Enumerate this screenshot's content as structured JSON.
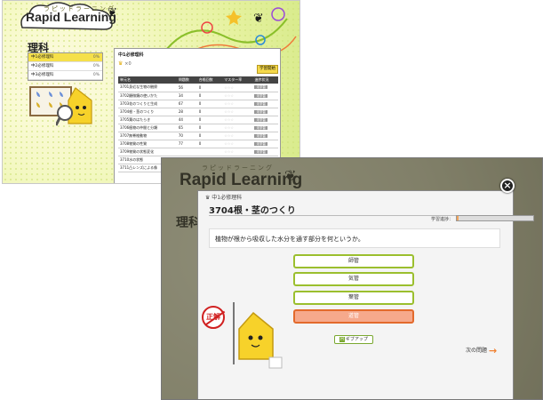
{
  "back": {
    "logo_sub": "ラピッドラーニング",
    "logo": "Rapid Learning",
    "section_title": "理科",
    "sidebar": [
      {
        "label": "中1必修理科",
        "pct": "0%",
        "active": true
      },
      {
        "label": "中2必修理科",
        "pct": "0%",
        "active": false
      },
      {
        "label": "中3必修理科",
        "pct": "0%",
        "active": false
      }
    ],
    "panel_title": "中1必修理科",
    "crown_count": "×0",
    "start_button": "学習開始",
    "columns": [
      "単元名",
      "問題数",
      "合格回数",
      "マスター率",
      "進捗状況"
    ],
    "rows": [
      {
        "name": "3701身近な生物の観察",
        "count": "56",
        "passed": "0"
      },
      {
        "name": "3702顕微鏡の使いかた",
        "count": "34",
        "passed": "0"
      },
      {
        "name": "3703花のつくりと生成",
        "count": "67",
        "passed": "0"
      },
      {
        "name": "3704根・茎のつくり",
        "count": "28",
        "passed": "0"
      },
      {
        "name": "3705葉のはたらき",
        "count": "44",
        "passed": "0"
      },
      {
        "name": "3706植物の仲間と分類",
        "count": "65",
        "passed": "0"
      },
      {
        "name": "3707無脊椎動物",
        "count": "70",
        "passed": "0"
      },
      {
        "name": "3708物質の性質",
        "count": "77",
        "passed": "0"
      },
      {
        "name": "3709物質の状態変化",
        "count": "",
        "passed": ""
      },
      {
        "name": "3710水の状態",
        "count": "",
        "passed": ""
      },
      {
        "name": "3711凸レンズによる像",
        "count": "",
        "passed": ""
      }
    ],
    "stars": "☆☆☆",
    "tag": "未学習"
  },
  "front": {
    "logo_sub": "ラピッドラーニング",
    "logo": "Rapid Learning",
    "side_title": "理科",
    "modal": {
      "breadcrumb": "中1必修理科",
      "title": "3704根・茎のつくり",
      "progress_label": "学習進捗：",
      "progress": 0.02,
      "question": "植物が根から吸収した水分を通す部分を何というか。",
      "options": [
        {
          "label": "師管",
          "selected": false
        },
        {
          "label": "気管",
          "selected": false
        },
        {
          "label": "葉管",
          "selected": false
        },
        {
          "label": "道管",
          "selected": true
        }
      ],
      "hint_badge": "H",
      "hint_label": "ギブアップ",
      "next_label": "次の問題",
      "correct_stamp": "正解"
    }
  },
  "colors": {
    "accent_green": "#9bbf2e",
    "selected_orange": "#e36a2c",
    "sidebar_yellow": "#f5e04a"
  }
}
